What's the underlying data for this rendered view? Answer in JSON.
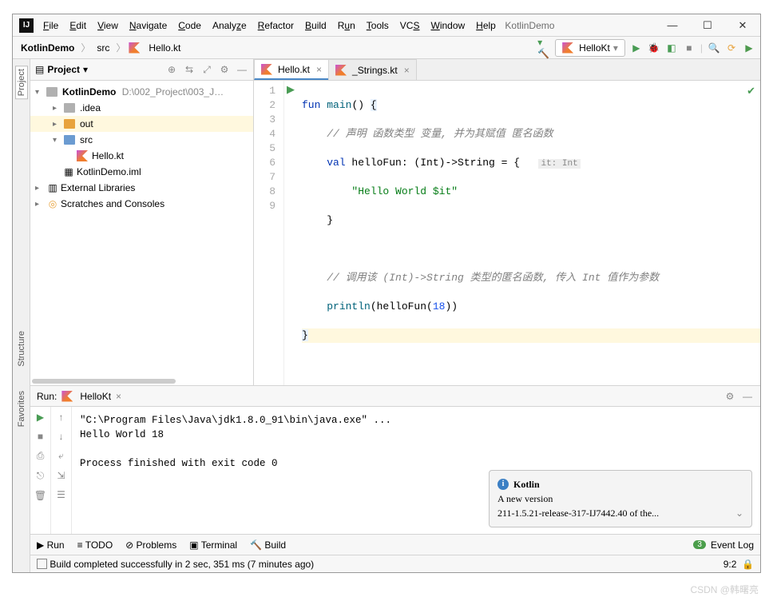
{
  "app": {
    "title": "KotlinDemo"
  },
  "menu": [
    "File",
    "Edit",
    "View",
    "Navigate",
    "Code",
    "Analyze",
    "Refactor",
    "Build",
    "Run",
    "Tools",
    "VCS",
    "Window",
    "Help"
  ],
  "breadcrumb": {
    "root": "KotlinDemo",
    "p1": "src",
    "p2": "Hello.kt"
  },
  "run_config": "HelloKt",
  "project_tool": {
    "title": "Project"
  },
  "tree": {
    "root": "KotlinDemo",
    "root_path": "D:\\002_Project\\003_J…",
    "idea": ".idea",
    "out": "out",
    "src": "src",
    "file1": "Hello.kt",
    "file2": "KotlinDemo.iml",
    "ext": "External Libraries",
    "scratch": "Scratches and Consoles"
  },
  "tabs": [
    {
      "label": "Hello.kt",
      "active": true
    },
    {
      "label": "_Strings.kt",
      "active": false
    }
  ],
  "gutter_lines": [
    "1",
    "2",
    "3",
    "4",
    "5",
    "6",
    "7",
    "8",
    "9"
  ],
  "code": {
    "l1_fun": "fun",
    "l1_main": "main",
    "l1_rest": "() ",
    "l1_brace": "{",
    "l2": "// 声明 函数类型 变量, 并为其赋值 匿名函数",
    "l3_val": "val",
    "l3_name": " helloFun: (Int)->String = ",
    "l3_brace": "{",
    "l3_hint": "it: Int",
    "l4": "\"Hello World $it\"",
    "l5": "}",
    "l7": "// 调用该 (Int)->String 类型的匿名函数, 传入 Int 值作为参数",
    "l8_fn": "println",
    "l8_open": "(helloFun(",
    "l8_num": "18",
    "l8_close": "))",
    "l9": "}"
  },
  "run_panel": {
    "label": "Run:",
    "tab": "HelloKt",
    "line1": "\"C:\\Program Files\\Java\\jdk1.8.0_91\\bin\\java.exe\" ...",
    "line2": "Hello World 18",
    "line3": "Process finished with exit code 0"
  },
  "notification": {
    "title": "Kotlin",
    "body1": "A new version",
    "body2": "211-1.5.21-release-317-IJ7442.40 of the..."
  },
  "footer": {
    "run": "Run",
    "todo": "TODO",
    "problems": "Problems",
    "terminal": "Terminal",
    "build": "Build",
    "eventlog": "Event Log",
    "badge": "3"
  },
  "status": {
    "msg": "Build completed successfully in 2 sec, 351 ms (7 minutes ago)",
    "pos": "9:2"
  },
  "side_left": {
    "project": "Project",
    "structure": "Structure",
    "favorites": "Favorites"
  },
  "watermark": "CSDN @韩曙亮"
}
